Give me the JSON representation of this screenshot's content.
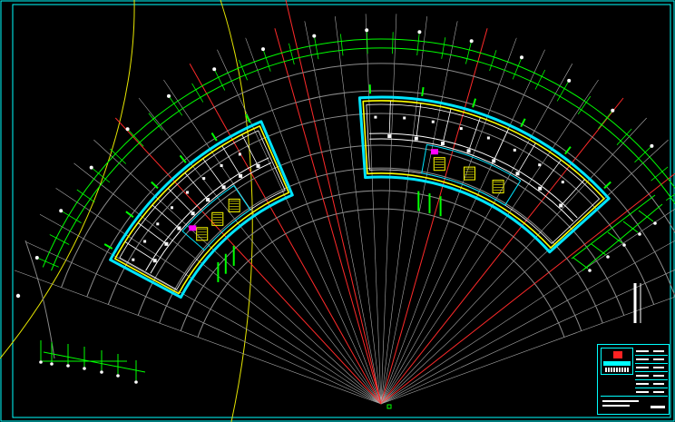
{
  "drawing": {
    "background": "#000000",
    "colors": {
      "frame": "#00ffff",
      "axis_main": "#aaaaaa",
      "axis_red": "#ff2a2a",
      "dimension": "#00ff00",
      "site_curve": "#e6e600",
      "wall_outline": "#ffff00",
      "wall_cyan": "#00e5ff",
      "wall_white": "#ffffff",
      "magenta": "#ff00ff"
    },
    "axis_count": 32,
    "red_axis_count": 6,
    "north_wing": "left",
    "south_wing": "right"
  },
  "title_block": {
    "logo_color": "#ff2222",
    "row_count": 6
  }
}
